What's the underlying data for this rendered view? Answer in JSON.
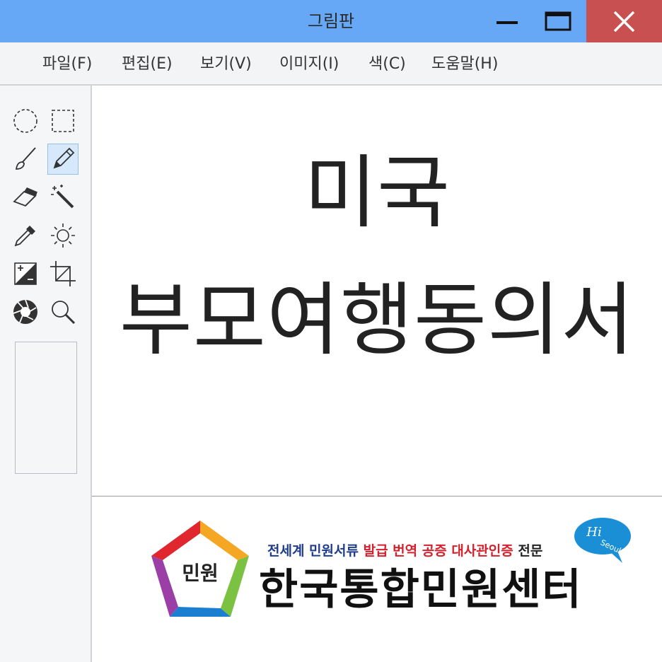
{
  "window": {
    "title": "그림판",
    "minimize_icon": "minimize-icon",
    "maximize_icon": "maximize-icon",
    "close_icon": "close-icon",
    "close_color": "#c85050",
    "titlebar_color": "#66a8f5"
  },
  "menu": {
    "items": [
      {
        "label": "파일(F)"
      },
      {
        "label": "편집(E)"
      },
      {
        "label": "보기(V)"
      },
      {
        "label": "이미지(I)"
      },
      {
        "label": "색(C)"
      },
      {
        "label": "도움말(H)"
      }
    ]
  },
  "tools": [
    {
      "name": "free-form-select-icon"
    },
    {
      "name": "rectangle-select-icon"
    },
    {
      "name": "brush-icon"
    },
    {
      "name": "pencil-icon",
      "active": true
    },
    {
      "name": "eraser-icon"
    },
    {
      "name": "magic-wand-icon"
    },
    {
      "name": "color-picker-icon"
    },
    {
      "name": "brightness-icon"
    },
    {
      "name": "contrast-icon"
    },
    {
      "name": "crop-icon"
    },
    {
      "name": "aperture-icon"
    },
    {
      "name": "magnifier-icon"
    }
  ],
  "document": {
    "line1": "미국",
    "line2": "부모여행동의서"
  },
  "banner": {
    "logo_text": "민원",
    "tagline_part1": "전세계 민원서류",
    "tagline_part2": "발급 번역 공증 대사관인증",
    "tagline_part3": "전문",
    "center_name": "한국통합민원센터",
    "badge_hi": "Hi",
    "badge_seoul": "Seoul",
    "colors": {
      "blue": "#1f3b8c",
      "red": "#d4202c",
      "badge": "#1a8fd6"
    }
  }
}
